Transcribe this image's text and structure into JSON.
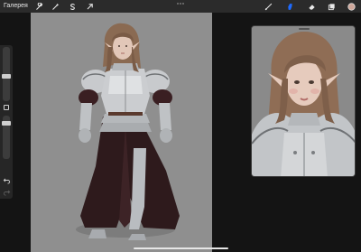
{
  "toolbar": {
    "gallery_label": "Галерея",
    "left_icons": [
      "wrench-icon",
      "magic-wand-icon",
      "selection-s-icon",
      "transform-arrow-icon"
    ],
    "right_icons": [
      "brush-icon",
      "smudge-icon",
      "eraser-icon",
      "layers-icon",
      "color-swatch-icon"
    ],
    "active_tool": "smudge-icon",
    "accent_color": "#1e6bff",
    "current_color": "#cfa79a"
  },
  "sidebar": {
    "icons": [
      "modify-square-icon",
      "undo-icon",
      "redo-icon"
    ]
  },
  "colors": {
    "canvas_bg": "#8f8f8f",
    "app_bg": "#141414",
    "toolbar_bg": "#2b2b2b"
  }
}
